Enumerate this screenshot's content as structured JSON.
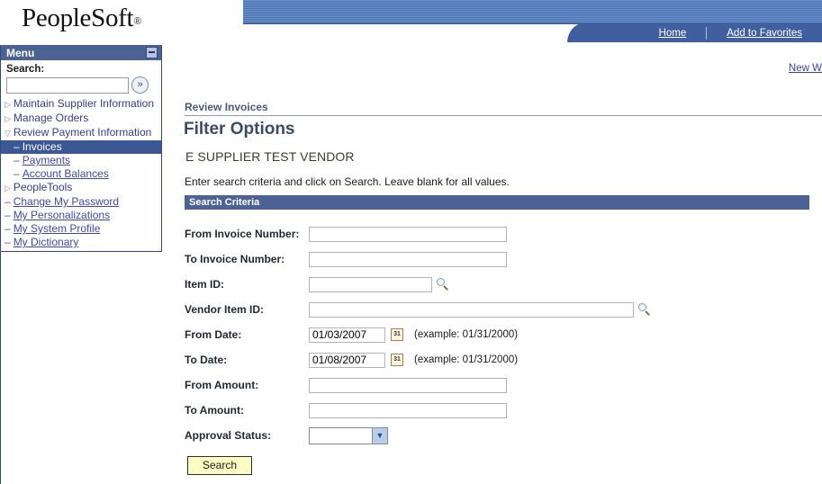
{
  "header": {
    "logo_text": "PeopleSoft",
    "logo_reg": "®",
    "nav": [
      {
        "label": "Home",
        "name": "home-link"
      },
      {
        "label": "Add to Favorites",
        "name": "add-to-favorites-link"
      }
    ]
  },
  "sidebar": {
    "title": "Menu",
    "search_label": "Search:",
    "search_value": "",
    "search_placeholder": "",
    "chevron_label": "»",
    "items": [
      {
        "label": "Maintain Supplier Information",
        "marker": "▷",
        "type": "folder",
        "selected": false
      },
      {
        "label": "Manage Orders",
        "marker": "▷",
        "type": "folder",
        "selected": false
      },
      {
        "label": "Review Payment Information",
        "marker": "▽",
        "type": "folder",
        "selected": false
      },
      {
        "label": "Invoices",
        "marker": "–",
        "type": "child",
        "selected": true
      },
      {
        "label": "Payments",
        "marker": "–",
        "type": "child-link",
        "selected": false
      },
      {
        "label": "Account Balances",
        "marker": "–",
        "type": "child-link",
        "selected": false
      },
      {
        "label": "PeopleTools",
        "marker": "▷",
        "type": "folder",
        "selected": false
      },
      {
        "label": "Change My Password",
        "marker": "–",
        "type": "link",
        "selected": false
      },
      {
        "label": "My Personalizations",
        "marker": "–",
        "type": "link",
        "selected": false
      },
      {
        "label": "My System Profile",
        "marker": "–",
        "type": "link",
        "selected": false
      },
      {
        "label": "My Dictionary",
        "marker": "–",
        "type": "link",
        "selected": false
      }
    ]
  },
  "main": {
    "new_window_link": "New Window",
    "breadcrumb": "Review Invoices",
    "page_title": "Filter Options",
    "vendor_name": "E SUPPLIER TEST VENDOR",
    "instruction": "Enter search criteria and click on Search. Leave blank for all values.",
    "section_header": "Search Criteria",
    "fields": {
      "from_invoice_number": {
        "label": "From Invoice Number:",
        "value": ""
      },
      "to_invoice_number": {
        "label": "To Invoice Number:",
        "value": ""
      },
      "item_id": {
        "label": "Item ID:",
        "value": ""
      },
      "vendor_item_id": {
        "label": "Vendor Item ID:",
        "value": ""
      },
      "from_date": {
        "label": "From Date:",
        "value": "01/03/2007",
        "hint": "(example: 01/31/2000)"
      },
      "to_date": {
        "label": "To Date:",
        "value": "01/08/2007",
        "hint": "(example: 01/31/2000)"
      },
      "from_amount": {
        "label": "From Amount:",
        "value": ""
      },
      "to_amount": {
        "label": "To Amount:",
        "value": ""
      },
      "approval_status": {
        "label": "Approval Status:",
        "value": "",
        "arrow": "▼"
      }
    },
    "calendar_icon_label": "31",
    "search_button": "Search"
  },
  "colors": {
    "header_blue": "#4a6fae",
    "nav_tab_blue": "#3f5f9e",
    "menu_header": "#4c6294",
    "selected_item": "#3c5795",
    "section_bar": "#4c6294",
    "link": "#3b41a0",
    "button_yellow": "#fbfbc4"
  }
}
